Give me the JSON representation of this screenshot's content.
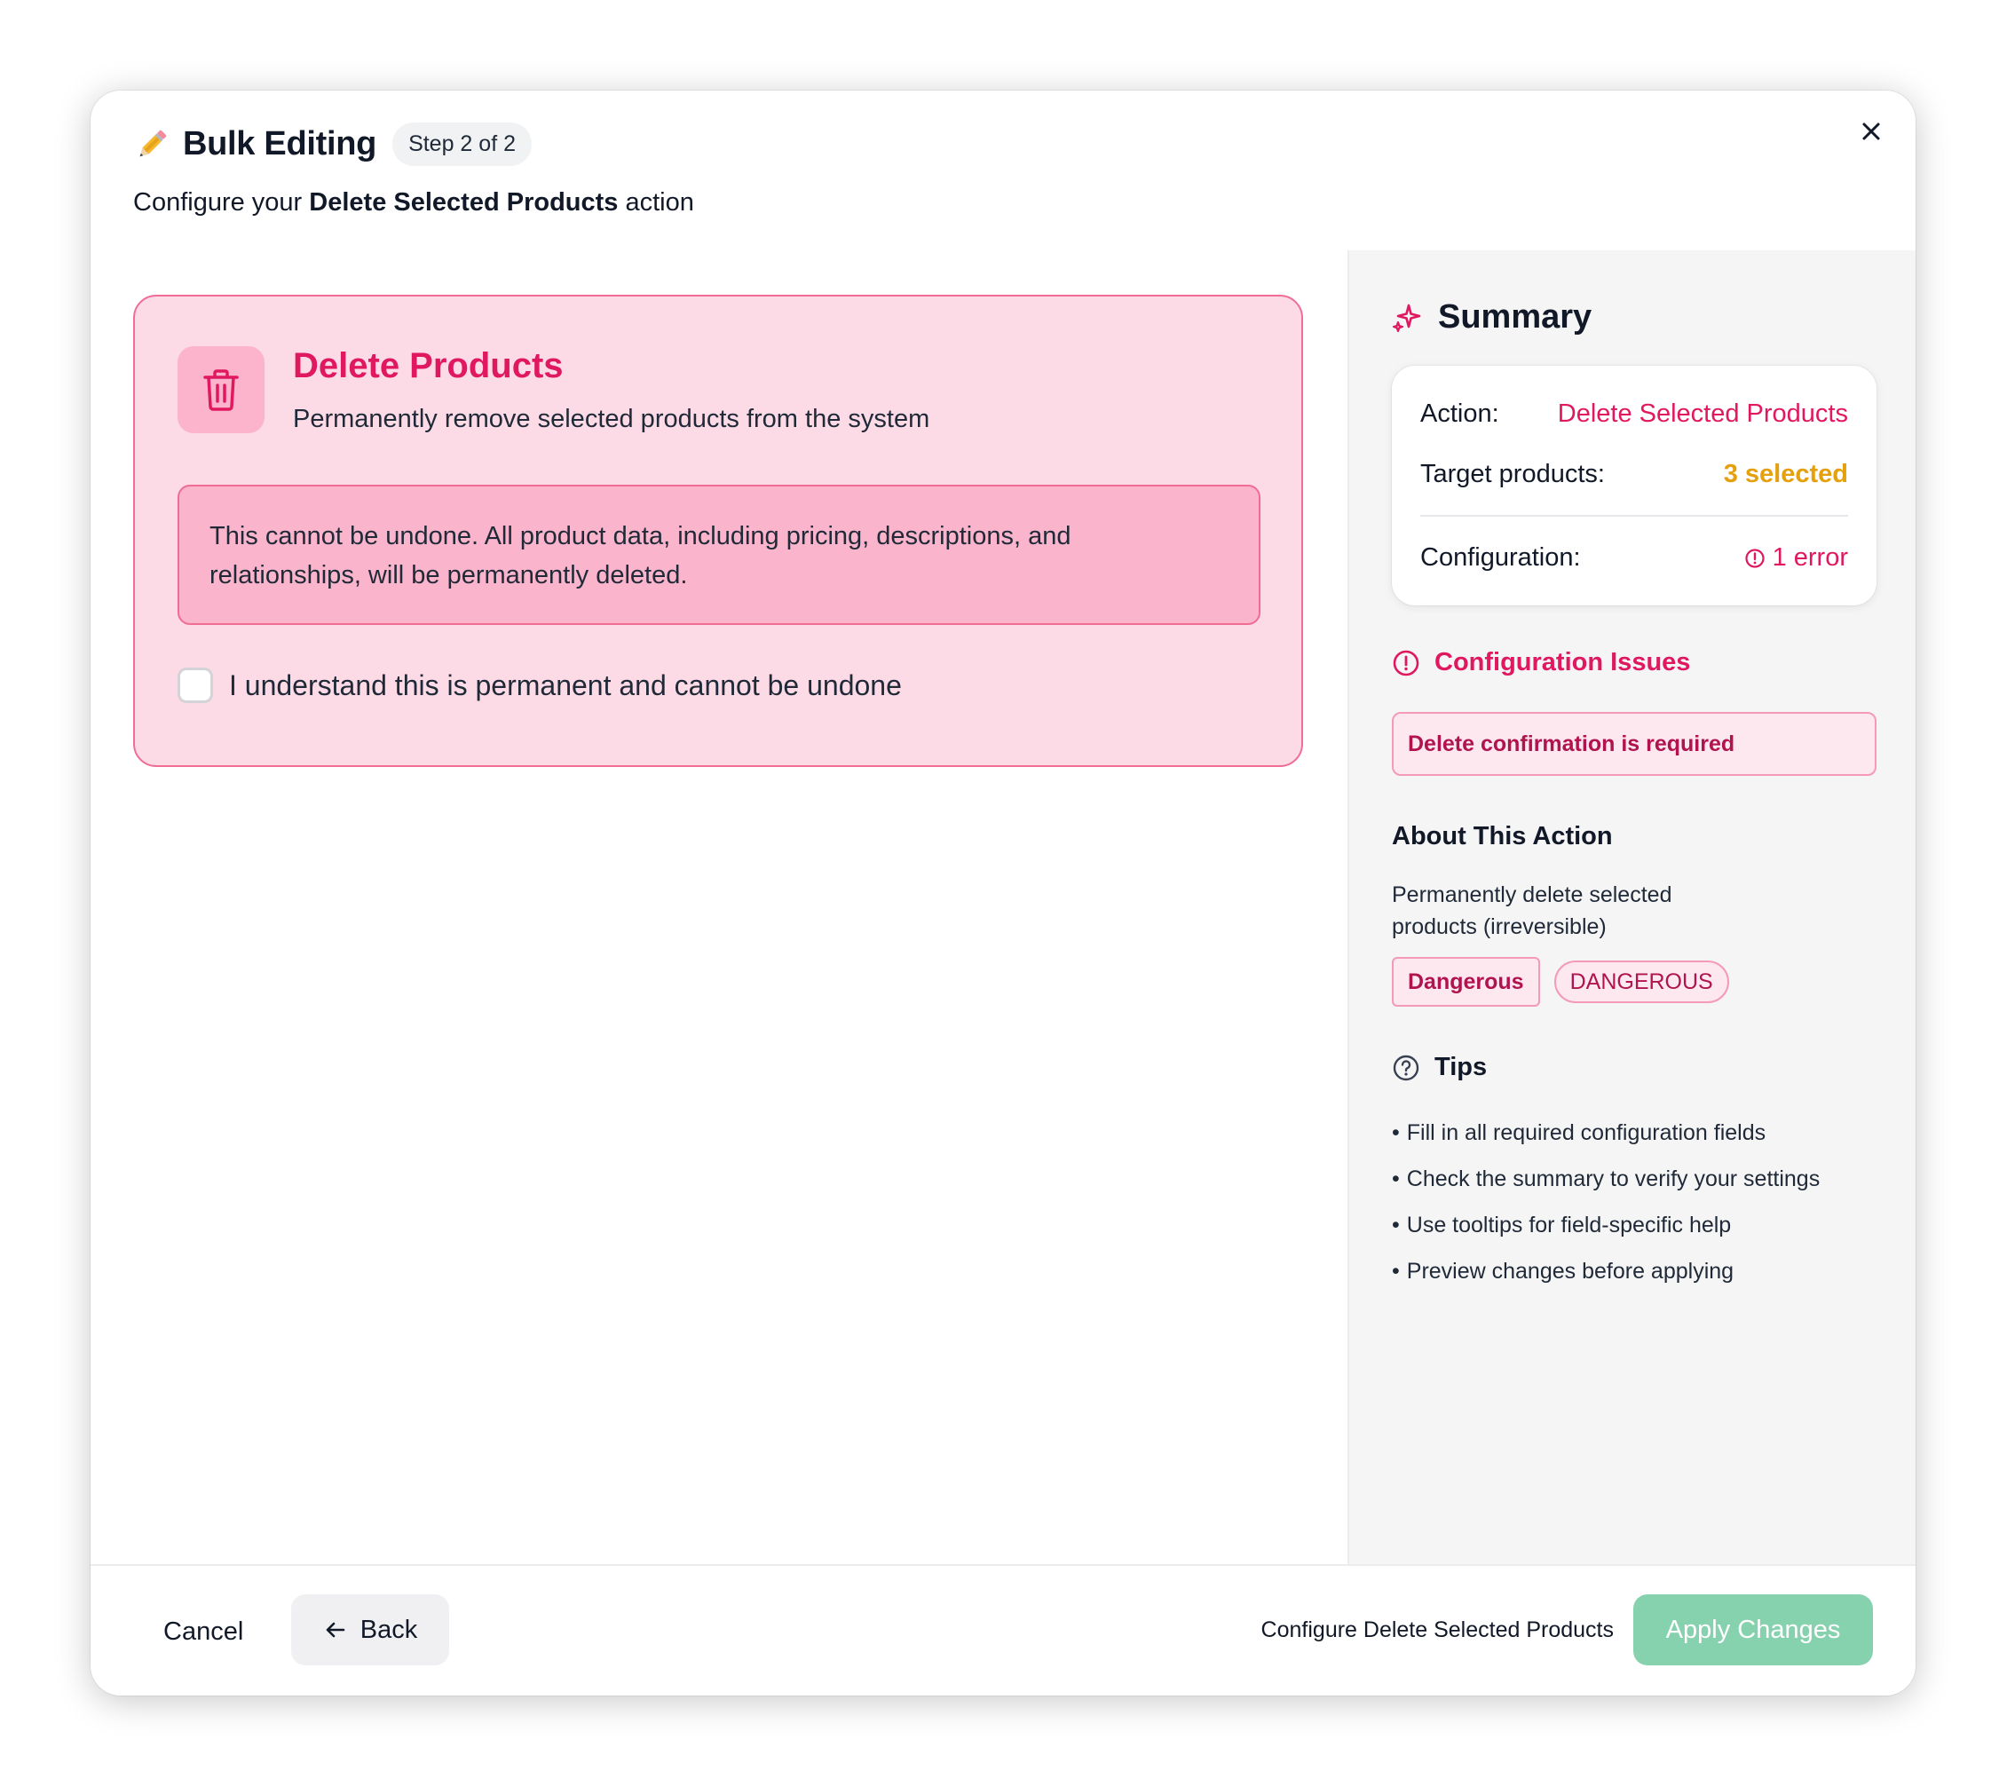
{
  "header": {
    "title": "Bulk Editing",
    "step_badge": "Step 2 of 2",
    "subtitle_prefix": "Configure your ",
    "subtitle_bold": "Delete Selected Products",
    "subtitle_suffix": " action",
    "icons": {
      "title": "pencil-icon",
      "close": "close-icon"
    }
  },
  "delete_card": {
    "title": "Delete Products",
    "description": "Permanently remove selected products from the system",
    "warning": "This cannot be undone. All product data, including pricing, descriptions, and relationships, will be permanently deleted.",
    "confirm_label": "I understand this is permanent and cannot be undone",
    "confirm_checked": false,
    "icon": "trash-icon"
  },
  "summary": {
    "title": "Summary",
    "icon": "sparkle-icon",
    "rows": [
      {
        "label": "Action:",
        "value": "Delete Selected Products"
      },
      {
        "label": "Target products:",
        "value": "3 selected"
      },
      {
        "label": "Configuration:",
        "value": "1 error"
      }
    ]
  },
  "issues": {
    "title": "Configuration Issues",
    "icon": "alert-circle-icon",
    "items": [
      "Delete confirmation is required"
    ]
  },
  "about": {
    "title": "About This Action",
    "description": "Permanently delete selected products (irreversible)",
    "badges": [
      "Dangerous",
      "DANGEROUS"
    ]
  },
  "tips": {
    "title": "Tips",
    "icon": "help-circle-icon",
    "items": [
      "Fill in all required configuration fields",
      "Check the summary to verify your settings",
      "Use tooltips for field-specific help",
      "Preview changes before applying"
    ]
  },
  "footer": {
    "cancel_label": "Cancel",
    "back_label": "Back",
    "status_text": "Configure Delete Selected Products",
    "apply_label": "Apply Changes"
  },
  "colors": {
    "accent_pink": "#e0185f",
    "warning_amber": "#e5a00d",
    "apply_green": "#86d2ae"
  }
}
